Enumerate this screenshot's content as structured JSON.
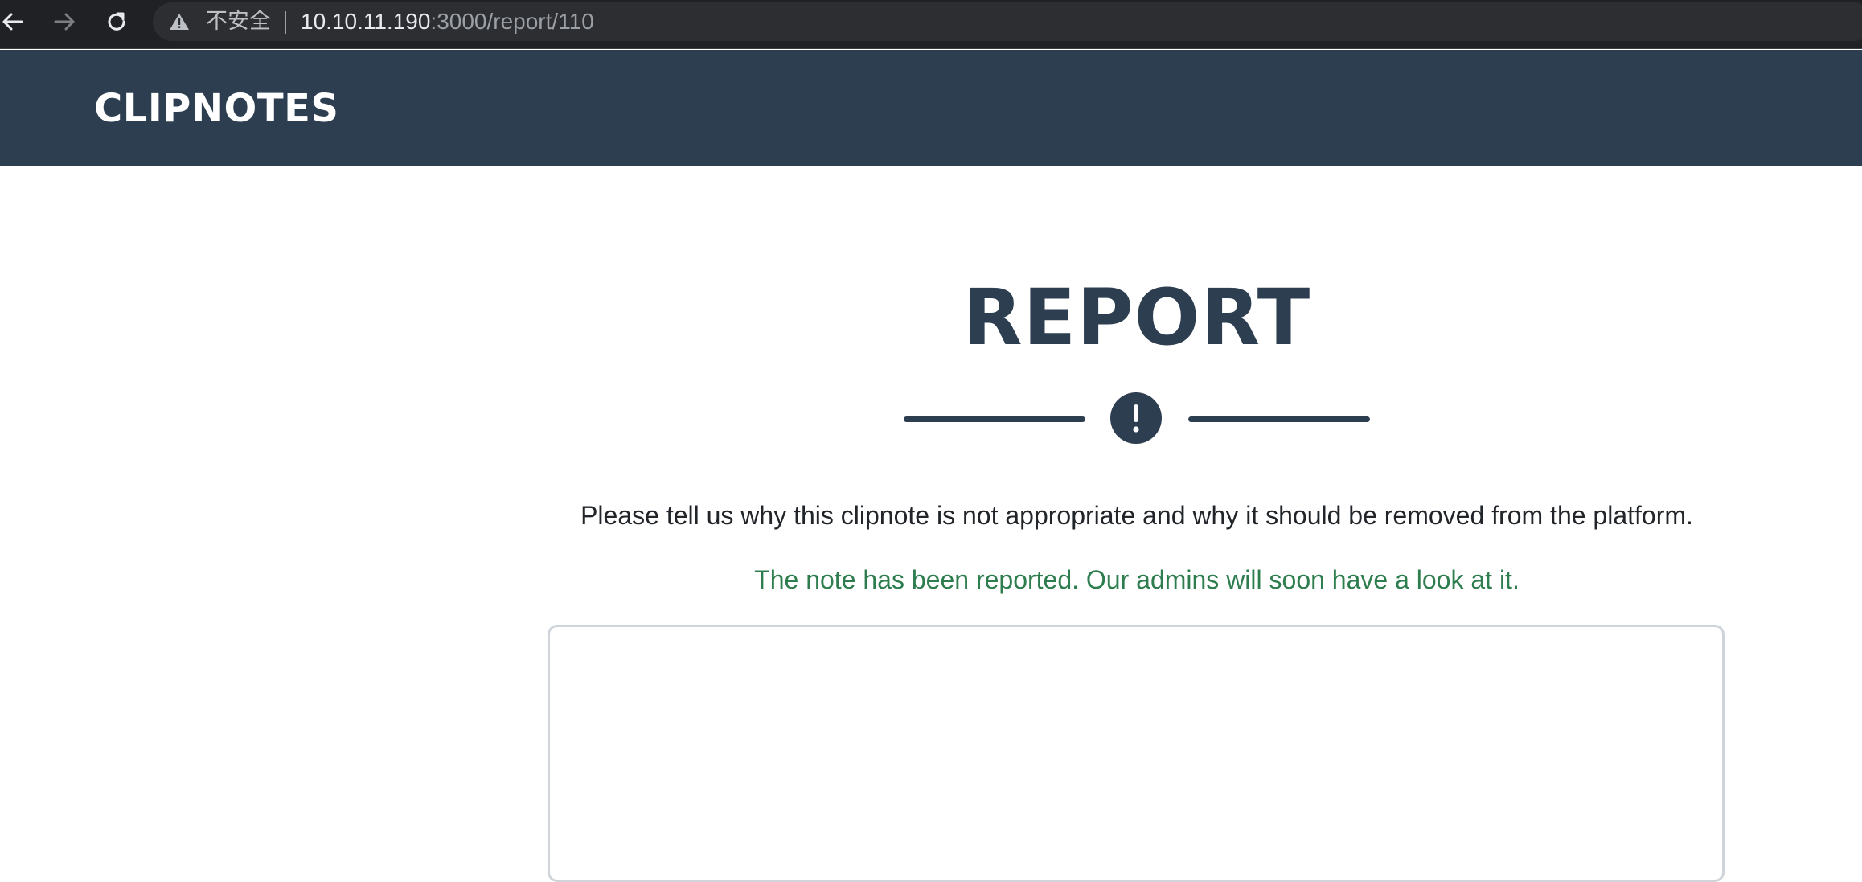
{
  "browser": {
    "security_label": "不安全",
    "url_host": "10.10.11.190",
    "url_path": ":3000/report/110",
    "icons": {
      "back": "back-arrow-icon",
      "forward": "forward-arrow-icon",
      "reload": "reload-icon",
      "warning": "warning-triangle-icon"
    }
  },
  "navbar": {
    "brand": "CLIPNOTES"
  },
  "main": {
    "title": "REPORT",
    "divider_icon": "exclamation-circle-icon",
    "instruction": "Please tell us why this clipnote is not appropriate and why it should be removed from the platform.",
    "success_message": "The note has been reported. Our admins will soon have a look at it.",
    "reason_value": ""
  },
  "colors": {
    "navbar_bg": "#2c3e50",
    "title": "#2c3e50",
    "success": "#2e7d4f",
    "input_border": "#ced4da"
  }
}
